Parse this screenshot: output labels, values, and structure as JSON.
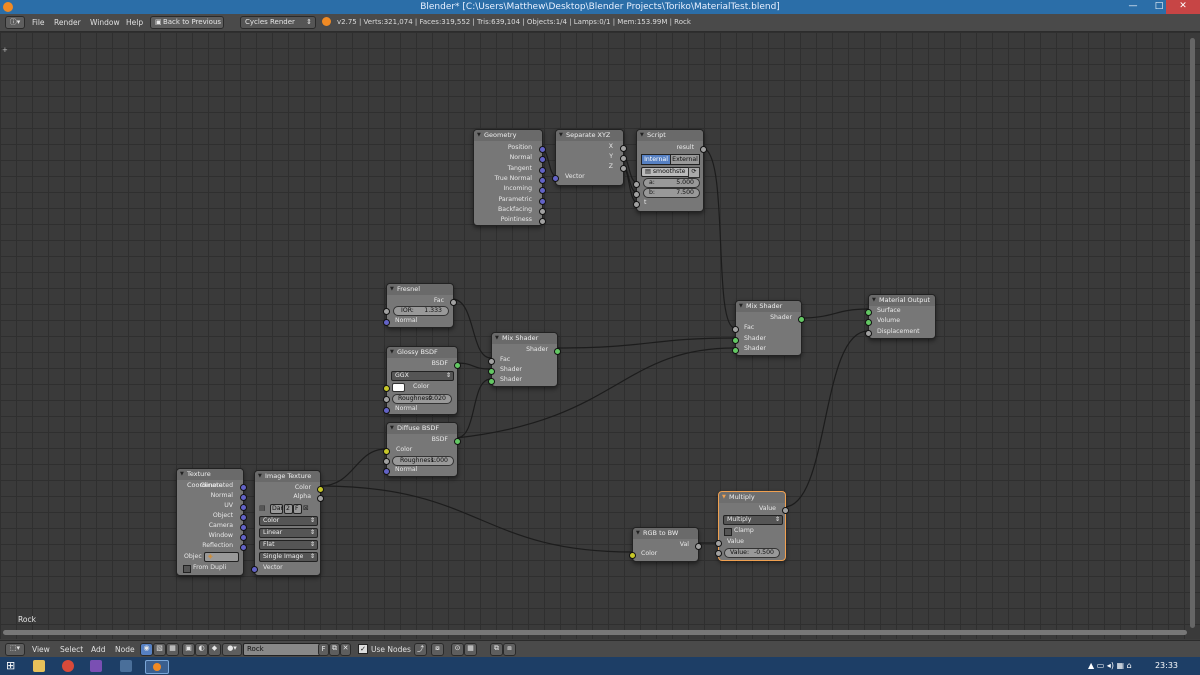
{
  "window": {
    "title": "Blender* [C:\\Users\\Matthew\\Desktop\\Blender Projects\\Toriko\\MaterialTest.blend]",
    "minimize": "—",
    "maximize": "□",
    "close": "✕"
  },
  "menubar": {
    "items": [
      "File",
      "Render",
      "Window",
      "Help"
    ],
    "back_button": "Back to Previous",
    "render_engine": "Cycles Render",
    "stats": "v2.75 | Verts:321,074 | Faces:319,552 | Tris:639,104 | Objects:1/4 | Lamps:0/1 | Mem:153.99M | Rock"
  },
  "nodes": {
    "geometry": {
      "title": "Geometry",
      "outputs": [
        "Position",
        "Normal",
        "Tangent",
        "True Normal",
        "Incoming",
        "Parametric",
        "Backfacing",
        "Pointiness"
      ]
    },
    "separate_xyz": {
      "title": "Separate XYZ",
      "outputs": [
        "X",
        "Y",
        "Z"
      ],
      "input": "Vector"
    },
    "script": {
      "title": "Script",
      "output": "result",
      "mode_internal": "Internal",
      "mode_external": "External",
      "script_name": "smoothste",
      "a_label": "a:",
      "a_value": "5.000",
      "b_label": "b:",
      "b_value": "7.500",
      "t_label": "t"
    },
    "fresnel": {
      "title": "Fresnel",
      "output": "Fac",
      "ior_label": "IOR:",
      "ior_value": "1.333",
      "input_normal": "Normal"
    },
    "glossy": {
      "title": "Glossy BSDF",
      "output": "BSDF",
      "distribution": "GGX",
      "color": "Color",
      "roughness_label": "Roughness:",
      "roughness_value": "0.020",
      "normal": "Normal"
    },
    "diffuse": {
      "title": "Diffuse BSDF",
      "output": "BSDF",
      "color": "Color",
      "roughness_label": "Roughness:",
      "roughness_value": "1.000",
      "normal": "Normal"
    },
    "mix1": {
      "title": "Mix Shader",
      "output": "Shader",
      "fac": "Fac",
      "shader1": "Shader",
      "shader2": "Shader"
    },
    "mix2": {
      "title": "Mix Shader",
      "output": "Shader",
      "fac": "Fac",
      "shader1": "Shader",
      "shader2": "Shader"
    },
    "material_output": {
      "title": "Material Output",
      "inputs": [
        "Surface",
        "Volume",
        "Displacement"
      ]
    },
    "tex_coord": {
      "title": "Texture Coordinate",
      "outputs": [
        "Generated",
        "Normal",
        "UV",
        "Object",
        "Camera",
        "Window",
        "Reflection"
      ],
      "object_label": "Objec",
      "from_dupli": "From Dupli"
    },
    "image_texture": {
      "title": "Image Texture",
      "out_color": "Color",
      "out_alpha": "Alpha",
      "image_name": "Dar",
      "image_users": "2",
      "image_fake": "F",
      "color_space": "Color",
      "interpolation": "Linear",
      "projection": "Flat",
      "source": "Single Image",
      "input_vector": "Vector"
    },
    "rgb_to_bw": {
      "title": "RGB to BW",
      "output": "Val",
      "input": "Color"
    },
    "multiply": {
      "title": "Multiply",
      "output": "Value",
      "operation": "Multiply",
      "clamp": "Clamp",
      "input_value": "Value",
      "value_label": "Value:",
      "value": "-0.500"
    }
  },
  "editor": {
    "material_label": "Rock"
  },
  "bottombar": {
    "items": [
      "View",
      "Select",
      "Add",
      "Node"
    ],
    "material_name": "Rock",
    "fake_user": "F",
    "use_nodes": "Use Nodes"
  },
  "taskbar": {
    "clock": "23:33"
  },
  "colors": {
    "title_bar": "#2b6ea8",
    "node_body": "#777777",
    "shader_socket": "#63c763",
    "vector_socket": "#6363c7",
    "color_socket": "#c7c729",
    "value_socket": "#a1a1a1",
    "active_node_border": "#f0a050"
  }
}
